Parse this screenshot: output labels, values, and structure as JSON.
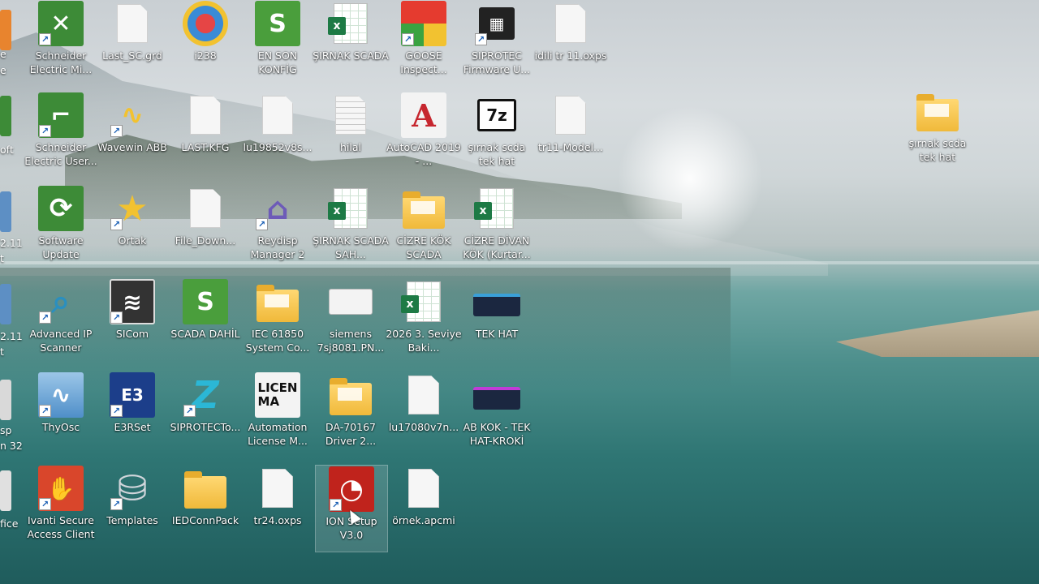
{
  "desktop": {
    "icons": [
      {
        "id": "schneider-mi",
        "label": "Schneider Electric Mi...",
        "type": "app",
        "color": "#3d8b37",
        "symbol": "✕"
      },
      {
        "id": "last-scgrd",
        "label": "Last_SC.grd",
        "type": "doc"
      },
      {
        "id": "i238",
        "label": "i238",
        "type": "app",
        "color": "#3a8bd6",
        "symbol": "●"
      },
      {
        "id": "en-son-konfig",
        "label": "EN SON KONFİG",
        "type": "app",
        "color": "#4a9e3c",
        "symbol": "S"
      },
      {
        "id": "sirnak-scada",
        "label": "ŞIRNAK SCADA",
        "type": "excel"
      },
      {
        "id": "goose-inspect",
        "label": "GOOSE Inspect...",
        "type": "app",
        "color": "#d9a21e",
        "symbol": "◆"
      },
      {
        "id": "siprotec-fw",
        "label": "SIPROTEC Firmware U...",
        "type": "app",
        "color": "#222222",
        "symbol": "▦"
      },
      {
        "id": "idili-oxps",
        "label": "idili tr 11.oxps",
        "type": "doc"
      },
      {
        "id": "schneider-user",
        "label": "Schneider Electric User...",
        "type": "app",
        "color": "#3d8b37",
        "symbol": "⌐"
      },
      {
        "id": "wavewin",
        "label": "Wavewin ABB",
        "type": "app",
        "color": "#2c5fa8",
        "symbol": "∿"
      },
      {
        "id": "last-kfg",
        "label": "LAST.KFG",
        "type": "doc"
      },
      {
        "id": "lu19852",
        "label": "lu19852v8s...",
        "type": "doc"
      },
      {
        "id": "hilal",
        "label": "hilal",
        "type": "doclines"
      },
      {
        "id": "autocad",
        "label": "AutoCAD 2019 - ...",
        "type": "app",
        "color": "#c6262e",
        "symbol": "A"
      },
      {
        "id": "sirnak-scda-tek-1",
        "label": "şırnak scda tek hat",
        "type": "app",
        "color": "#ffffff",
        "symbol": "7z"
      },
      {
        "id": "tr11-model",
        "label": "tr11-Model...",
        "type": "doc"
      },
      {
        "id": "software-update",
        "label": "Software Update",
        "type": "app",
        "color": "#3d8b37",
        "symbol": "⟳"
      },
      {
        "id": "ortak",
        "label": "Ortak",
        "type": "app",
        "color": "#f2c230",
        "symbol": "★"
      },
      {
        "id": "file-down",
        "label": "File_Down...",
        "type": "doc"
      },
      {
        "id": "reydisp",
        "label": "Reydisp Manager 2",
        "type": "app",
        "color": "#6d5bb8",
        "symbol": "⌂"
      },
      {
        "id": "sirnak-scada-sah",
        "label": "ŞIRNAK SCADA SAH...",
        "type": "excel"
      },
      {
        "id": "cizre-kok-scada",
        "label": "CİZRE KÖK SCADA",
        "type": "folder"
      },
      {
        "id": "cizre-divan",
        "label": "CİZRE DİVAN KÖK (Kurtar...",
        "type": "excel"
      },
      {
        "id": "advanced-ip",
        "label": "Advanced IP Scanner",
        "type": "app",
        "color": "#2a8fbf",
        "symbol": "⌕"
      },
      {
        "id": "sicom",
        "label": "SICom",
        "type": "app",
        "color": "#333333",
        "symbol": "≋"
      },
      {
        "id": "scada-dahil",
        "label": "SCADA DAHİL",
        "type": "app",
        "color": "#4a9e3c",
        "symbol": "S"
      },
      {
        "id": "iec61850",
        "label": "IEC 61850 System Co...",
        "type": "folder"
      },
      {
        "id": "siemens-7sj",
        "label": "siemens 7sj8081.PN...",
        "type": "image"
      },
      {
        "id": "seviye-bak",
        "label": "2026 3. Seviye Baki...",
        "type": "excel"
      },
      {
        "id": "tek-hat",
        "label": "TEK HAT",
        "type": "thumb"
      },
      {
        "id": "thyosc",
        "label": "ThyOsc",
        "type": "app",
        "color": "#4f8fc9",
        "symbol": "∿"
      },
      {
        "id": "e3rset",
        "label": "E3RSet",
        "type": "app",
        "color": "#1c3e8a",
        "symbol": "E3"
      },
      {
        "id": "siprotec-tools",
        "label": "SIPROTECTo...",
        "type": "app",
        "color": "#2bb7d6",
        "symbol": "Z"
      },
      {
        "id": "automation-license",
        "label": "Automation License M...",
        "type": "app",
        "color": "#1a1a1a",
        "symbol": "LICEN MA"
      },
      {
        "id": "da70167",
        "label": "DA-70167 Driver 2...",
        "type": "folder"
      },
      {
        "id": "lu17080",
        "label": "lu17080v7n...",
        "type": "doc"
      },
      {
        "id": "ab-kok",
        "label": "AB KOK - TEK HAT-KROKİ",
        "type": "thumb"
      },
      {
        "id": "ivanti",
        "label": "Ivanti Secure Access Client",
        "type": "app",
        "color": "#d9462b",
        "symbol": "✋"
      },
      {
        "id": "templates",
        "label": "Templates",
        "type": "app",
        "color": "#b0b7bf",
        "symbol": "⛁"
      },
      {
        "id": "iedconnpack",
        "label": "IEDConnPack",
        "type": "folder"
      },
      {
        "id": "tr24-oxps",
        "label": "tr24.oxps",
        "type": "doc"
      },
      {
        "id": "ion-setup",
        "label": "ION Setup V3.0",
        "type": "app",
        "color": "#c0231c",
        "symbol": "◔"
      },
      {
        "id": "ornek-apcmi",
        "label": "örnek.apcmi",
        "type": "doc"
      },
      {
        "id": "sirnak-scda-tek-2",
        "label": "şırnak scda tek hat",
        "type": "folder"
      }
    ],
    "edge_labels": [
      "e",
      "e",
      "oft",
      "2.11",
      "t",
      "2.11",
      "t",
      "sp",
      "n 32",
      "fice"
    ]
  }
}
